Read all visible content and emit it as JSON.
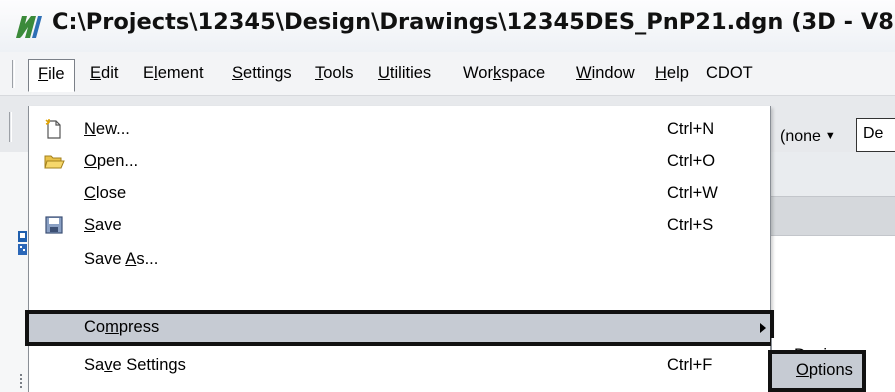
{
  "window": {
    "title": "C:\\Projects\\12345\\Design\\Drawings\\12345DES_PnP21.dgn (3D - V8"
  },
  "menubar": {
    "items": [
      {
        "label": "File",
        "u": "F",
        "rest": "ile"
      },
      {
        "label": "Edit",
        "u": "E",
        "rest": "dit"
      },
      {
        "label": "Element",
        "pre": "E",
        "u": "l",
        "rest": "ement"
      },
      {
        "label": "Settings",
        "u": "S",
        "rest": "ettings"
      },
      {
        "label": "Tools",
        "u": "T",
        "rest": "ools"
      },
      {
        "label": "Utilities",
        "u": "U",
        "rest": "tilities"
      },
      {
        "label": "Workspace",
        "pre": "Wor",
        "u": "k",
        "rest": "space"
      },
      {
        "label": "Window",
        "u": "W",
        "rest": "indow"
      },
      {
        "label": "Help",
        "u": "H",
        "rest": "elp"
      },
      {
        "label": "CDOT"
      }
    ]
  },
  "toolbar": {
    "level_dropdown": "(none",
    "de_field": "De"
  },
  "file_menu": {
    "items": [
      {
        "pre": "",
        "u": "N",
        "rest": "ew...",
        "shortcut": "Ctrl+N",
        "icon": "new-file-icon"
      },
      {
        "pre": "",
        "u": "O",
        "rest": "pen...",
        "shortcut": "Ctrl+O",
        "icon": "open-folder-icon"
      },
      {
        "pre": "",
        "u": "C",
        "rest": "lose",
        "shortcut": "Ctrl+W",
        "icon": ""
      },
      {
        "pre": "",
        "u": "S",
        "rest": "ave",
        "shortcut": "Ctrl+S",
        "icon": "save-disk-icon"
      },
      {
        "pre": "Save ",
        "u": "A",
        "rest": "s...",
        "shortcut": "",
        "icon": ""
      },
      {
        "pre": "Co",
        "u": "m",
        "rest": "press",
        "shortcut": "",
        "icon": "",
        "submenu": true
      },
      {
        "pre": "Sa",
        "u": "v",
        "rest": "e Settings",
        "shortcut": "Ctrl+F",
        "icon": ""
      }
    ]
  },
  "compress_submenu": {
    "items": [
      {
        "pre": "",
        "u": "D",
        "rest": "esign"
      },
      {
        "pre": "",
        "u": "O",
        "rest": "ptions"
      }
    ]
  },
  "colors": {
    "highlight_bg": "#c6cbd3",
    "highlight_border": "#111111",
    "menu_bg": "#ffffff",
    "toolbar_bg": "#e7e9ec"
  }
}
